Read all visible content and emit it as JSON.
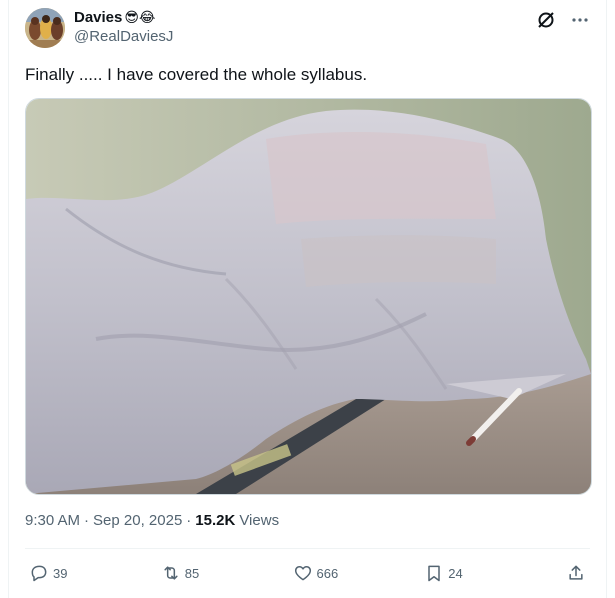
{
  "author": {
    "display_name": "Davies",
    "emojis": "😎😂",
    "handle": "@RealDaviesJ"
  },
  "tweet": {
    "text": "Finally ..... I have covered the whole syllabus.",
    "time": "9:30 AM",
    "date": "Sep 20, 2025",
    "views_count": "15.2K",
    "views_label": "Views"
  },
  "stats": {
    "replies": "39",
    "reposts": "85",
    "likes": "666",
    "bookmarks": "24"
  },
  "icons": {
    "grok": "grok-icon",
    "more": "more-icon",
    "reply": "reply-icon",
    "repost": "repost-icon",
    "like": "heart-icon",
    "bookmark": "bookmark-icon",
    "share": "share-icon"
  },
  "colors": {
    "text_primary": "#0f1419",
    "text_secondary": "#536471",
    "border": "#cfd9de"
  }
}
